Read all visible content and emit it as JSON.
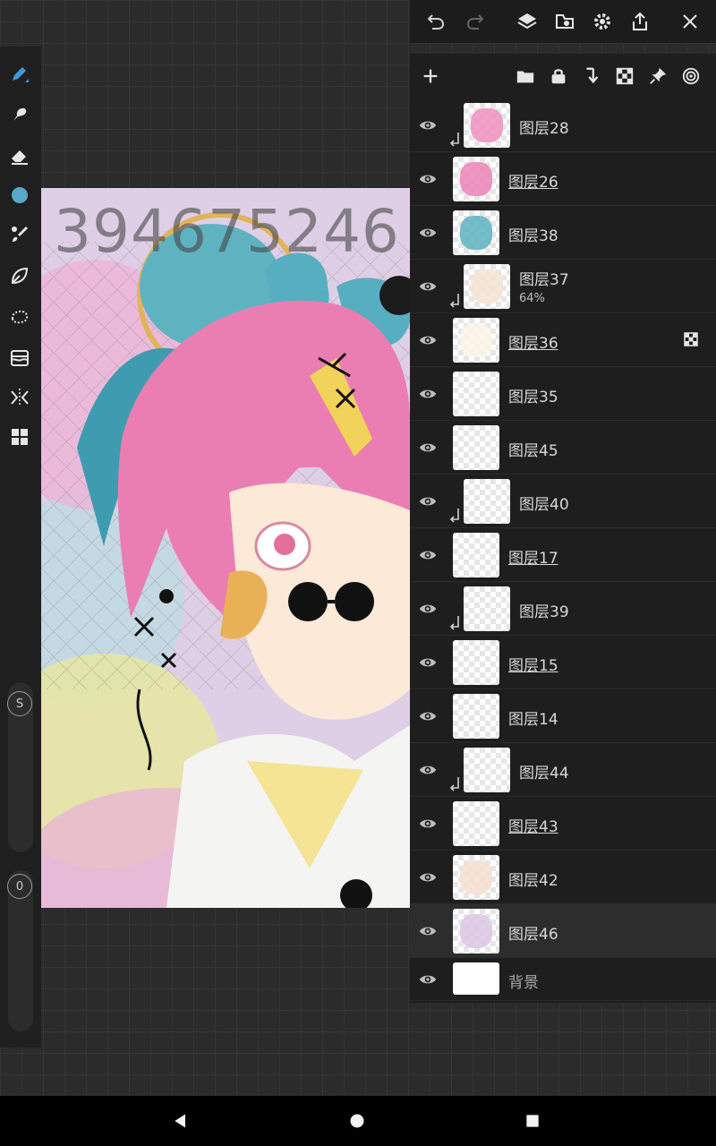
{
  "colors": {
    "accent": "#3a9bdc",
    "current_color": "#5aa8c7",
    "panel_bg": "#1e1e1e",
    "selected_row": "#2d2d2d"
  },
  "toolbar_left": {
    "tools": [
      "pen-icon",
      "smudge-icon",
      "eraser-icon",
      "color-swatch",
      "brush-icon",
      "lasso-fill-icon",
      "selection-icon",
      "filter-icon",
      "symmetry-icon",
      "layout-icon"
    ],
    "size_slider_label": "S",
    "opacity_slider_label": "0"
  },
  "top_bar": {
    "buttons": [
      "undo-icon",
      "redo-icon",
      "layers-icon",
      "transform-icon",
      "settings-icon",
      "share-icon",
      "close-icon"
    ]
  },
  "layers_toolbar": {
    "buttons": [
      "add-layer-icon",
      "folder-icon",
      "lock-icon",
      "merge-down-icon",
      "alpha-lock-icon",
      "pin-icon",
      "blend-icon"
    ]
  },
  "canvas": {
    "watermark": "394675246"
  },
  "layers": [
    {
      "name": "图层28",
      "clipped": true,
      "underline": false,
      "opacity": ""
    },
    {
      "name": "图层26",
      "clipped": false,
      "underline": true,
      "opacity": ""
    },
    {
      "name": "图层38",
      "clipped": false,
      "underline": false,
      "opacity": ""
    },
    {
      "name": "图层37",
      "clipped": true,
      "underline": false,
      "opacity": "64%"
    },
    {
      "name": "图层36",
      "clipped": false,
      "underline": true,
      "opacity": "",
      "alpha_lock": true
    },
    {
      "name": "图层35",
      "clipped": false,
      "underline": false,
      "opacity": ""
    },
    {
      "name": "图层45",
      "clipped": false,
      "underline": false,
      "opacity": ""
    },
    {
      "name": "图层40",
      "clipped": true,
      "underline": false,
      "opacity": ""
    },
    {
      "name": "图层17",
      "clipped": false,
      "underline": true,
      "opacity": ""
    },
    {
      "name": "图层39",
      "clipped": true,
      "underline": false,
      "opacity": ""
    },
    {
      "name": "图层15",
      "clipped": false,
      "underline": true,
      "opacity": ""
    },
    {
      "name": "图层14",
      "clipped": false,
      "underline": false,
      "opacity": ""
    },
    {
      "name": "图层44",
      "clipped": true,
      "underline": false,
      "opacity": ""
    },
    {
      "name": "图层43",
      "clipped": false,
      "underline": true,
      "opacity": ""
    },
    {
      "name": "图层42",
      "clipped": false,
      "underline": false,
      "opacity": ""
    },
    {
      "name": "图层46",
      "clipped": false,
      "underline": false,
      "opacity": "",
      "selected": true
    },
    {
      "name": "背景",
      "clipped": false,
      "underline": false,
      "opacity": "",
      "background": true
    }
  ],
  "nav": {
    "buttons": [
      "back-icon",
      "home-icon",
      "recents-icon"
    ]
  }
}
